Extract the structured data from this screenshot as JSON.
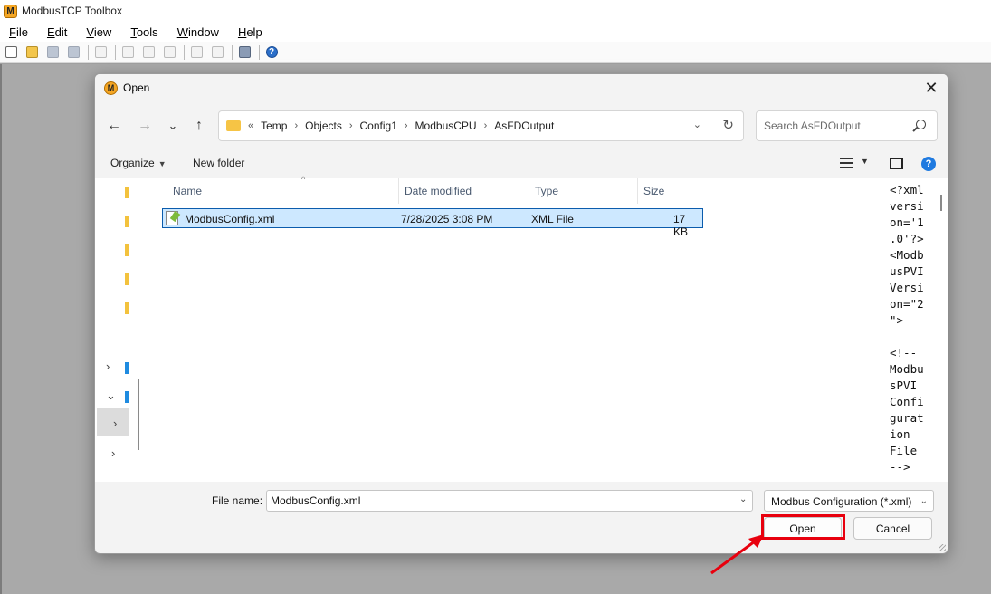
{
  "app": {
    "logo_letter": "M",
    "title": "ModbusTCP Toolbox",
    "menu": [
      "File",
      "Edit",
      "View",
      "Tools",
      "Window",
      "Help"
    ]
  },
  "toolbar": {
    "icons": [
      "new-icon",
      "open-folder-icon",
      "save-icon",
      "save-all-icon",
      "print-icon",
      "cut-icon",
      "copy-icon",
      "paste-icon",
      "undo-icon",
      "redo-icon",
      "properties-icon",
      "help-icon"
    ]
  },
  "dialog": {
    "title": "Open",
    "logo_letter": "M",
    "close_glyph": "✕",
    "nav": {
      "back": "←",
      "forward": "→",
      "recent": "⌄",
      "up": "↑"
    },
    "breadcrumb": {
      "overflow": "«",
      "items": [
        "Temp",
        "Objects",
        "Config1",
        "ModbusCPU",
        "AsFDOutput"
      ]
    },
    "search": {
      "placeholder": "Search AsFDOutput"
    },
    "commands": {
      "organize": "Organize",
      "new_folder": "New folder",
      "help": "?"
    },
    "columns": [
      "Name",
      "Date modified",
      "Type",
      "Size"
    ],
    "files": [
      {
        "name": "ModbusConfig.xml",
        "date": "7/28/2025 3:08 PM",
        "type": "XML File",
        "size": "17 KB"
      }
    ],
    "preview_text": "<?xml\nversi\non='1\n.0'?>\n<Modb\nusPVI\nVersi\non=\"2\n\">\n\n<!--\nModbu\nsPVI\nConfi\ngurat\nion\nFile\n-->",
    "file_name_label": "File name:",
    "file_name_value": "ModbusConfig.xml",
    "file_type": "Modbus Configuration (*.xml)",
    "open_label": "Open",
    "cancel_label": "Cancel"
  },
  "colors": {
    "highlight": "#e8000e",
    "selection": "#cde8ff",
    "accent": "#1f7ae0"
  }
}
